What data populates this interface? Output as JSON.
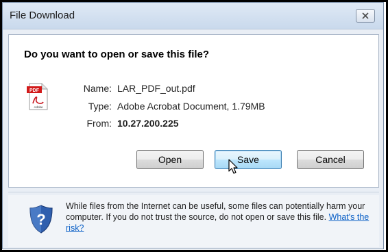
{
  "window": {
    "title": "File Download",
    "close_label": "✕"
  },
  "question": "Do you want to open or save this file?",
  "file": {
    "name_label": "Name:",
    "name_value": "LAR_PDF_out.pdf",
    "type_label": "Type:",
    "type_value": "Adobe Acrobat Document, 1.79MB",
    "from_label": "From:",
    "from_value": "10.27.200.225",
    "icon": "pdf-file-icon",
    "icon_badge": "PDF",
    "icon_caption": "Adobe"
  },
  "buttons": {
    "open": "Open",
    "save": "Save",
    "cancel": "Cancel"
  },
  "warning": {
    "icon": "shield-question-icon",
    "text": "While files from the Internet can be useful, some files can potentially harm your computer. If you do not trust the source, do not open or save this file. ",
    "link": "What's the risk?"
  },
  "colors": {
    "accent": "#3c7fb1",
    "link": "#0a5fc6",
    "pdf_red": "#d21a1a"
  }
}
